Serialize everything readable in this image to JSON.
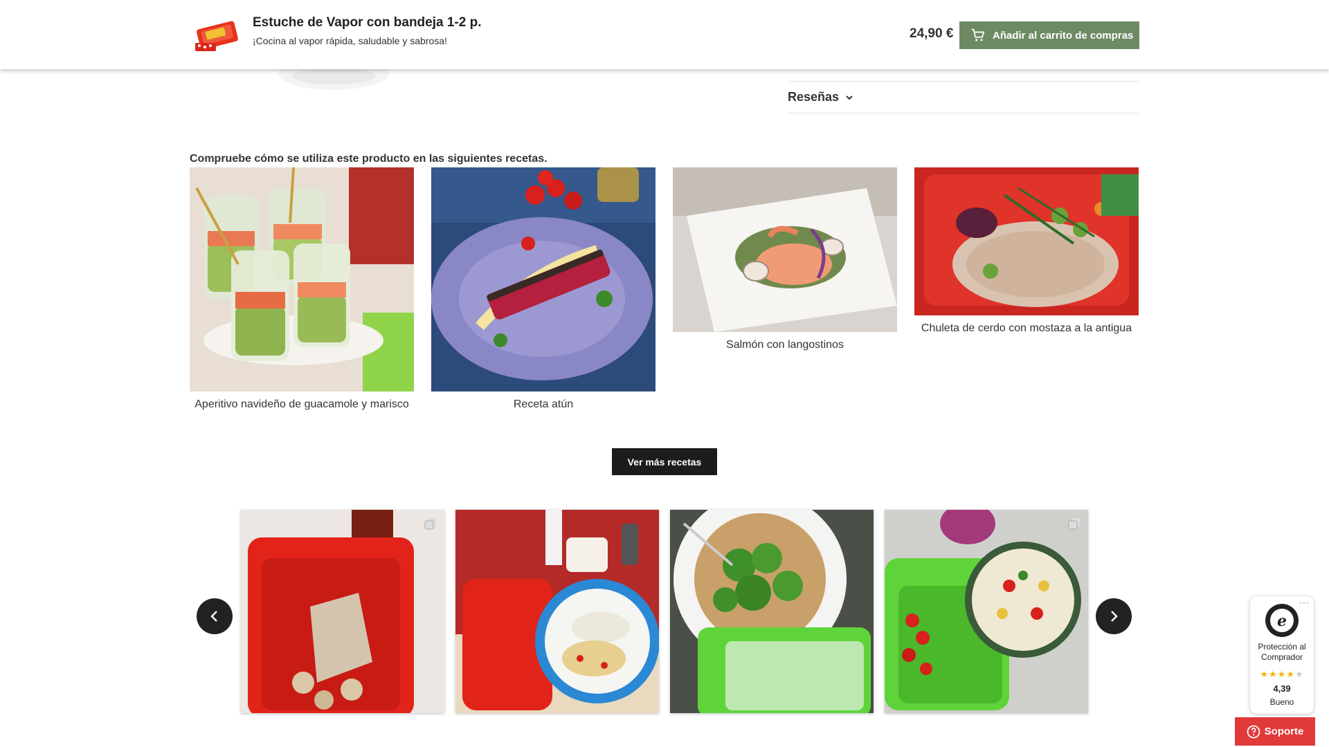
{
  "sticky_header": {
    "product_title": "Estuche de Vapor con bandeja 1-2 p.",
    "product_subtitle": "¡Cocina al vapor rápida, saludable y sabrosa!",
    "price": "24,90 €",
    "add_to_cart_label": "Añadir al carrito de compras",
    "cart_icon": "shopping-cart-icon"
  },
  "reviews": {
    "label": "Reseñas",
    "icon": "chevron-down-icon"
  },
  "recipes": {
    "heading": "Compruebe cómo se utiliza este producto en las siguientes recetas.",
    "items": [
      {
        "caption": "Aperitivo navideño de guacamole y marisco"
      },
      {
        "caption": "Receta atún"
      },
      {
        "caption": "Salmón con langostinos"
      },
      {
        "caption": "Chuleta de cerdo con mostaza a la antigua"
      }
    ],
    "more_button_label": "Ver más recetas"
  },
  "carousel": {
    "prev_icon": "chevron-left-icon",
    "next_icon": "chevron-right-icon",
    "photo_count": 4
  },
  "trusted_shops": {
    "menu": "···",
    "protection_label": "Protección al Comprador",
    "rating": "4,39",
    "rating_text": "Bueno",
    "rating_value": 4.39,
    "rating_max": 5
  },
  "support": {
    "label": "Soporte",
    "icon": "help-circle-icon"
  },
  "colors": {
    "cart_button": "#6d8a63",
    "dark_button": "#1c1c1c",
    "support_button": "#e03a3a",
    "star": "#f5b301"
  }
}
